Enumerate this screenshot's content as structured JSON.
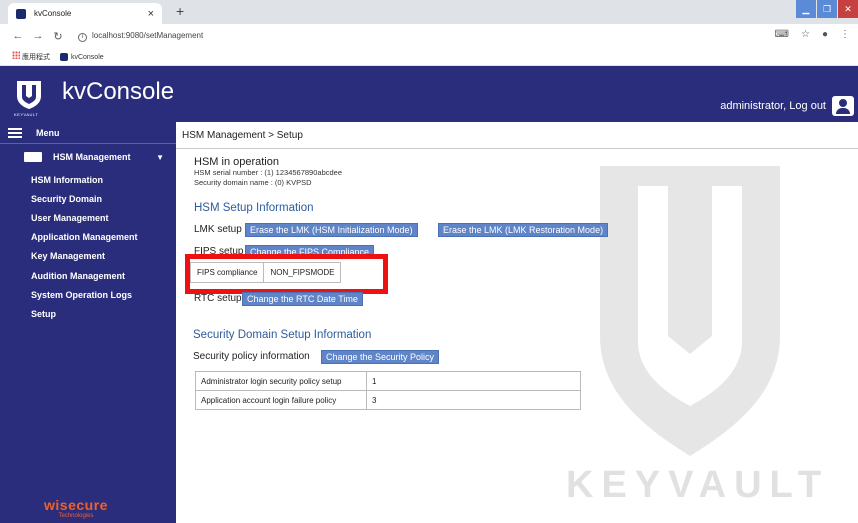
{
  "browser": {
    "tab_title": "kvConsole",
    "tab_close": "×",
    "new_tab": "+",
    "url": "localhost:9080/setManagement",
    "bookmarks": [
      "應用程式",
      "kvConsole"
    ]
  },
  "header": {
    "app_title": "kvConsole",
    "logo_subtext": "KEYVAULT",
    "user_text": "administrator, Log out"
  },
  "sidebar": {
    "menu_label": "Menu",
    "group_label": "HSM Management",
    "items": [
      "HSM Information",
      "Security Domain",
      "User Management",
      "Application Management",
      "Key Management",
      "Audition Management",
      "System Operation Logs",
      "Setup"
    ],
    "brand_name": "wisecure",
    "brand_sub": "Technologies"
  },
  "content": {
    "breadcrumb": "HSM Management > Setup",
    "hsm_status": "HSM in operation",
    "hsm_serial": "HSM serial number : (1) 1234567890abcdee",
    "security_domain_name": "Security domain name : (0) KVPSD",
    "hsm_setup_title": "HSM Setup Information",
    "lmk_label": "LMK setup",
    "lmk_btn_init": "Erase the LMK (HSM Initialization Mode)",
    "lmk_btn_restore": "Erase the LMK (LMK Restoration Mode)",
    "fips_label": "FIPS setup",
    "fips_btn": "Change the FIPS Compliance",
    "fips_key": "FIPS compliance",
    "fips_value": "NON_FIPSMODE",
    "rtc_label": "RTC setup",
    "rtc_btn": "Change the RTC Date Time",
    "sd_title": "Security Domain Setup Information",
    "policy_label": "Security policy information",
    "policy_btn": "Change the Security Policy",
    "policy_rows": [
      {
        "name": "Administrator login security policy setup",
        "value": "1"
      },
      {
        "name": "Application account login failure policy",
        "value": "3"
      }
    ],
    "watermark": "KEYVAULT"
  }
}
